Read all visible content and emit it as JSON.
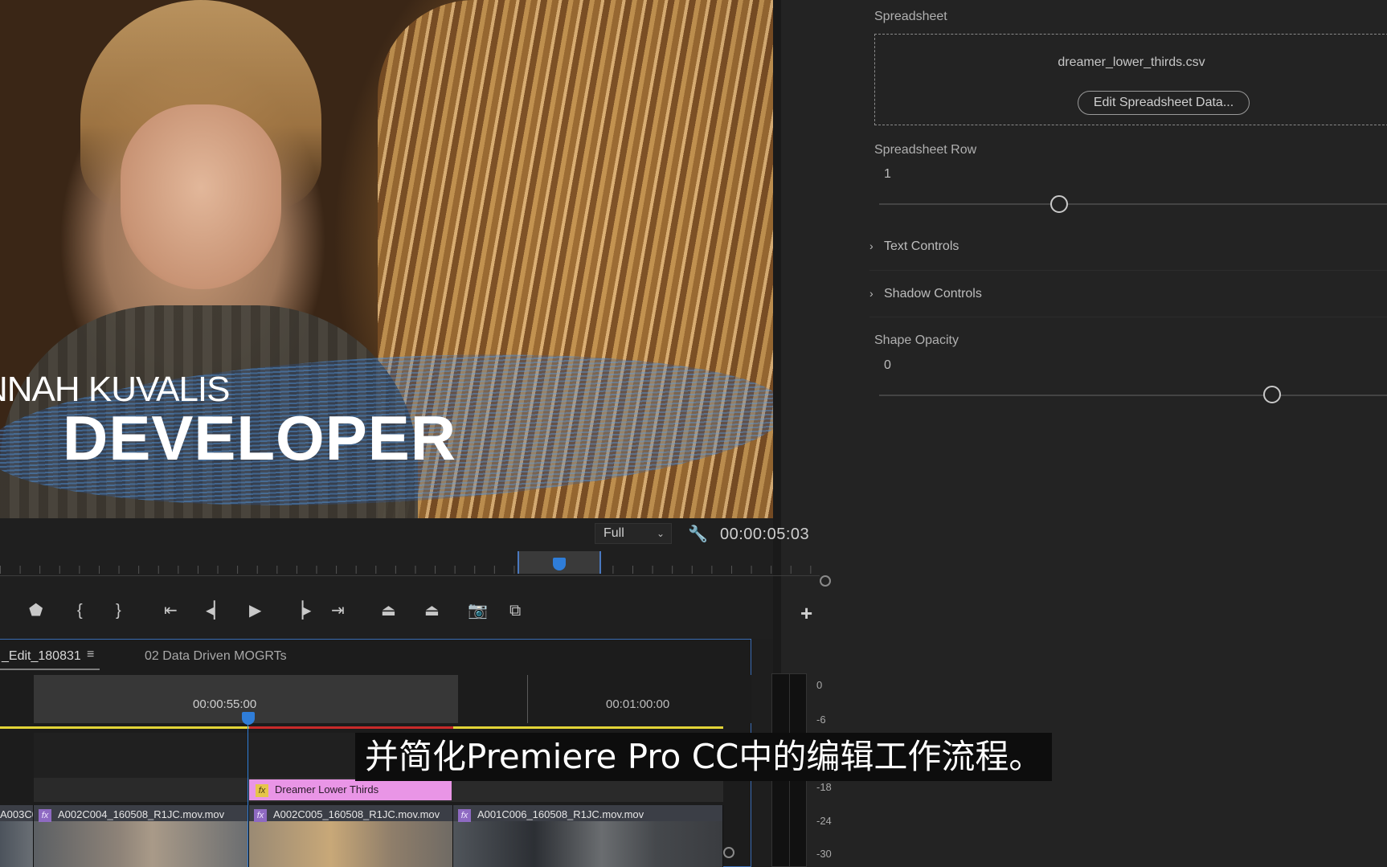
{
  "program_monitor": {
    "lower_third_name": "NNAH KUVALIS",
    "lower_third_title": "DEVELOPER",
    "resolution": "Full",
    "timecode": "00:00:05:03"
  },
  "essential_graphics": {
    "spreadsheet_label": "Spreadsheet",
    "spreadsheet_file": "dreamer_lower_thirds.csv",
    "edit_button": "Edit Spreadsheet Data...",
    "row_label": "Spreadsheet Row",
    "row_value": "1",
    "text_controls": "Text Controls",
    "shadow_controls": "Shadow Controls",
    "opacity_label": "Shape Opacity",
    "opacity_value": "0"
  },
  "timeline": {
    "tab_active": "_Edit_180831",
    "tab_menu_icon": "≡",
    "tab_other": "02 Data Driven MOGRTs",
    "tc_a": "00:00:55:00",
    "tc_b": "00:01:00:00",
    "graphic_clip": "Dreamer Lower Thirds",
    "fx": "fx",
    "clips": [
      {
        "label": "A003C0"
      },
      {
        "label": "A002C004_160508_R1JC.mov.mov"
      },
      {
        "label": "A002C005_160508_R1JC.mov.mov"
      },
      {
        "label": "A001C006_160508_R1JC.mov.mov"
      }
    ]
  },
  "meter_scale": [
    "0",
    "-6",
    "-18",
    "-24",
    "-30"
  ],
  "subtitle": "并简化Premiere Pro CC中的编辑工作流程。",
  "colors": {
    "accent_blue": "#2f7dd8",
    "work_area_yellow": "#e2d437",
    "render_red": "#c82a2a",
    "graphic_clip": "#e995e6"
  }
}
